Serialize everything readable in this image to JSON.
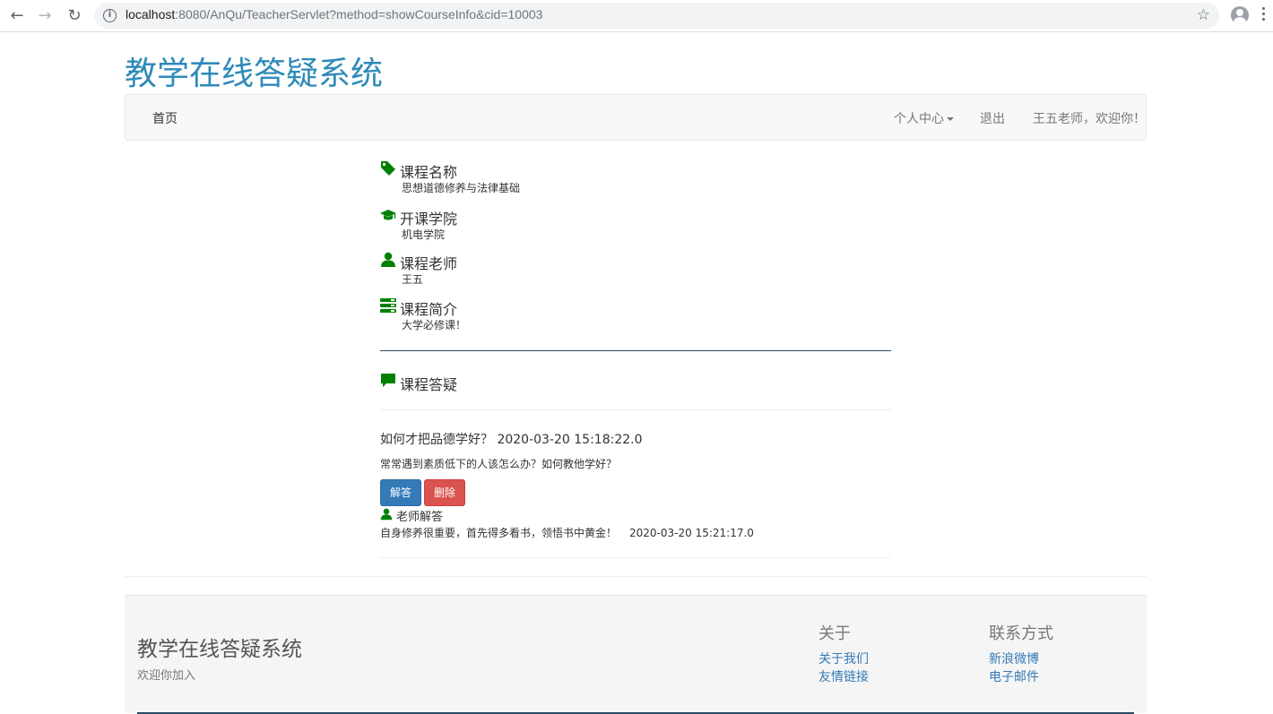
{
  "browser": {
    "url_host": "localhost",
    "url_rest": ":8080/AnQu/TeacherServlet?method=showCourseInfo&cid=10003"
  },
  "site": {
    "title": "教学在线答疑系统"
  },
  "navbar": {
    "home": "首页",
    "personal_center": "个人中心",
    "logout": "退出",
    "welcome": "王五老师，欢迎你！"
  },
  "course": {
    "name_label": "课程名称",
    "name_value": "思想道德修养与法律基础",
    "college_label": "开课学院",
    "college_value": "机电学院",
    "teacher_label": "课程老师",
    "teacher_value": "王五",
    "intro_label": "课程简介",
    "intro_value": "大学必修课！"
  },
  "qa": {
    "title": "课程答疑",
    "question_title": "如何才把品德学好？ 2020-03-20 15:18:22.0",
    "question_body": "常常遇到素质低下的人该怎么办？如何教他学好？",
    "answer_button": "解答",
    "delete_button": "删除",
    "teacher_answer_label": "老师解答",
    "answer_text": "自身修养很重要，首先得多看书，领悟书中黄金！",
    "answer_time": "2020-03-20 15:21:17.0"
  },
  "footer": {
    "title": "教学在线答疑系统",
    "subtitle": "欢迎你加入",
    "about_heading": "关于",
    "about_us": "关于我们",
    "friend_links": "友情链接",
    "contact_heading": "联系方式",
    "weibo": "新浪微博",
    "email": "电子邮件"
  },
  "colors": {
    "title_blue": "#2e8ab8",
    "icon_green": "#008000",
    "primary": "#337ab7",
    "danger": "#d9534f"
  }
}
